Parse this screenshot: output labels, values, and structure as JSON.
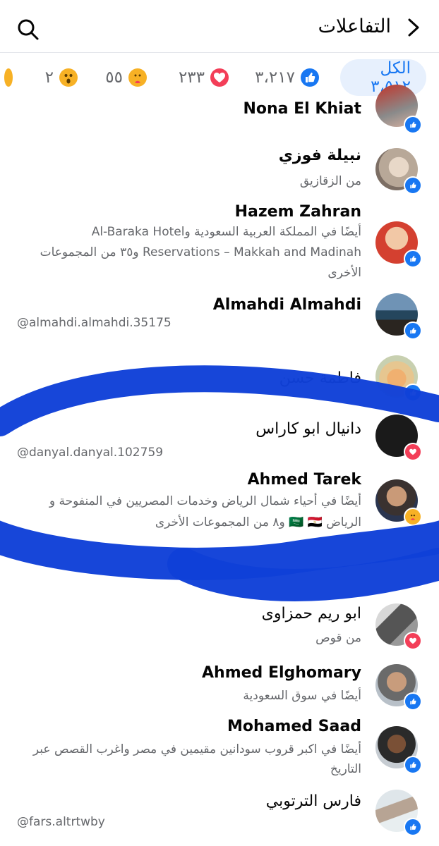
{
  "header": {
    "title": "التفاعلات",
    "back_icon": "chevron-back-icon",
    "search_icon": "search-icon"
  },
  "tabs": [
    {
      "label": "الكل ٣،٥١٢",
      "active": true
    },
    {
      "reaction": "like",
      "count": "٣،٢١٧",
      "color": "#1877f2"
    },
    {
      "reaction": "love",
      "count": "٢٣٣",
      "color": "#f33e58"
    },
    {
      "reaction": "care",
      "count": "٥٥",
      "color": "#f7b125"
    },
    {
      "reaction": "wow",
      "count": "٢",
      "color": "#f7b125"
    }
  ],
  "people": [
    {
      "name": "Nona El Khiat",
      "reaction": "like"
    },
    {
      "name": "نبيلة فوزي",
      "subtitle": "من الزقازيق",
      "reaction": "like"
    },
    {
      "name": "Hazem Zahran",
      "subtitle_lines": [
        "أيضًا في المملكة العربية السعودية وAl-Baraka Hotel",
        "Reservations – Makkah and Madinah و٣٥ من المجموعات",
        "الأخرى"
      ],
      "reaction": "like"
    },
    {
      "name": "Almahdi Almahdi",
      "handle": "@almahdi.almahdi.35175",
      "reaction": "like"
    },
    {
      "name": "فاطمة حسن",
      "reaction": "like"
    },
    {
      "name": "دانيال ابو كاراس",
      "handle": "@danyal.danyal.102759",
      "reaction": "love"
    },
    {
      "name": "Ahmed Tarek",
      "subtitle_lines": [
        "أيضًا في أحياء  شمال الرياض وخدمات المصريين في المنفوحة و",
        "الرياض 🇸🇦 🇪🇬 و٨ من المجموعات الأخرى"
      ],
      "reaction": "care"
    },
    {
      "name": "ابو ريم حمزاوى",
      "subtitle": "من قوص",
      "reaction": "love"
    },
    {
      "name": "Ahmed Elghomary",
      "subtitle": "أيضًا في سوق السعودية",
      "reaction": "like"
    },
    {
      "name": "Mohamed Saad",
      "subtitle_lines": [
        "أيضًا في اكبر قروب سودانين مقيمين في مصر واغرب القصص عبر",
        "التاريخ"
      ],
      "reaction": "like"
    },
    {
      "name": "فارس الترتوبي",
      "handle": "@fars.altrtwby",
      "reaction": "like"
    }
  ],
  "colors": {
    "accent": "#1877f2",
    "love": "#f33e58",
    "care": "#f7b125",
    "scribble": "#1040d8"
  }
}
